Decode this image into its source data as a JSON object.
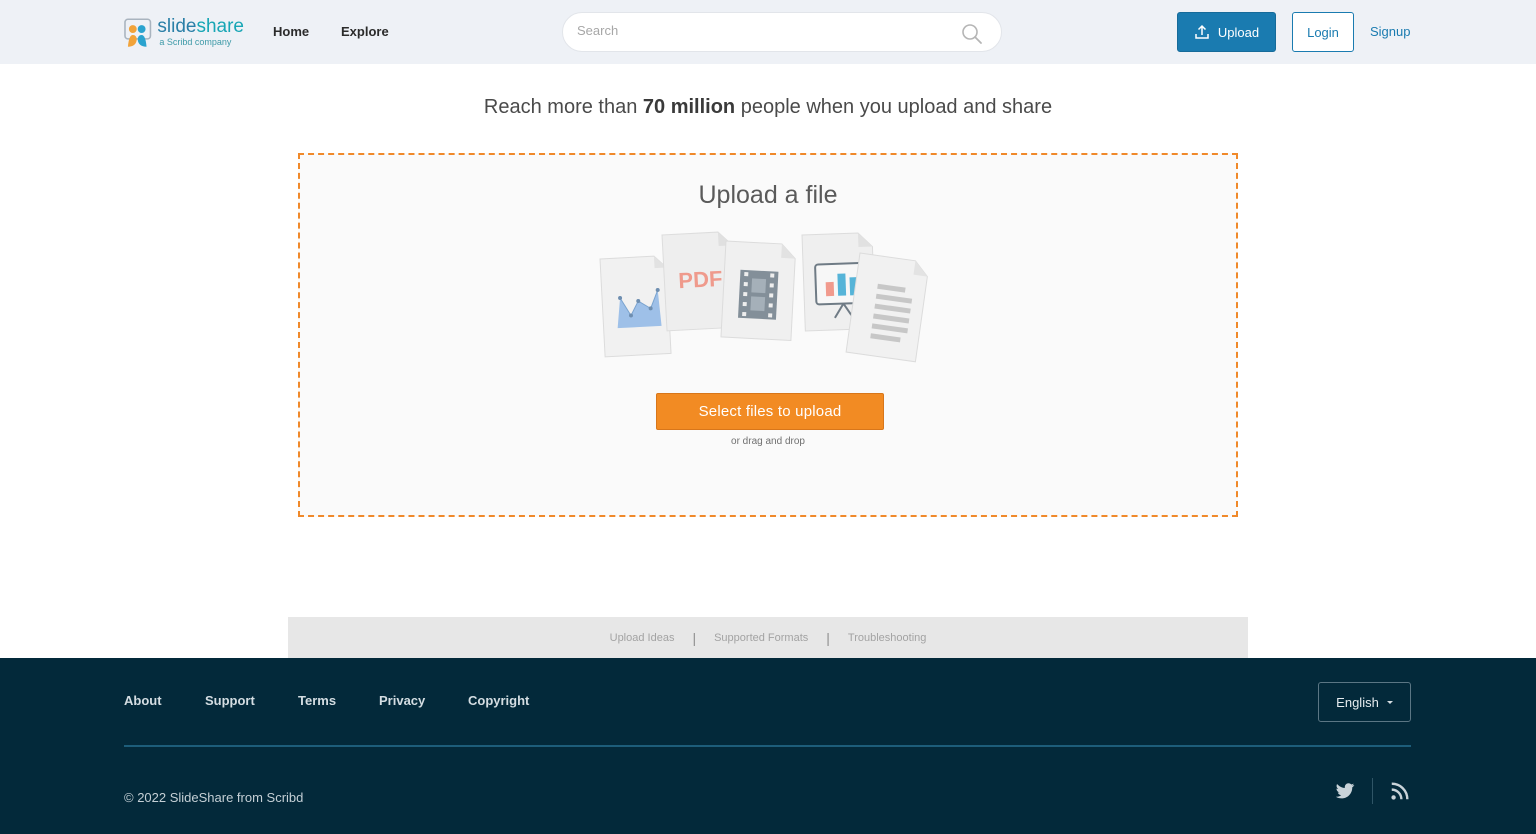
{
  "header": {
    "logo": {
      "word_a": "slide",
      "word_b": "share",
      "tagline": "a Scribd company"
    },
    "nav": {
      "home": "Home",
      "explore": "Explore"
    },
    "search": {
      "placeholder": "Search"
    },
    "upload_label": "Upload",
    "login_label": "Login",
    "signup_label": "Signup"
  },
  "main": {
    "headline": {
      "before": "Reach more than ",
      "bold": "70 million",
      "after": " people when you upload and share"
    },
    "upload": {
      "title": "Upload a file",
      "file_icons": [
        "chart-file-icon",
        "pdf-file-icon",
        "video-file-icon",
        "presentation-file-icon",
        "document-file-icon"
      ],
      "pdf_text": "PDF",
      "select_label": "Select files to upload",
      "drag_text": "or drag and drop"
    },
    "help": {
      "ideas": "Upload Ideas",
      "formats": "Supported Formats",
      "troubleshooting": "Troubleshooting",
      "separator": "|"
    }
  },
  "footer": {
    "links": {
      "about": "About",
      "support": "Support",
      "terms": "Terms",
      "privacy": "Privacy",
      "copyright": "Copyright"
    },
    "language": "English",
    "copyright_text": "© 2022 SlideShare from Scribd",
    "social_icons": [
      "twitter-icon",
      "rss-icon"
    ]
  },
  "colors": {
    "brand_blue": "#1a7bb0",
    "accent_orange": "#f28b23",
    "footer_bg": "#03293a",
    "header_bg": "#eef1f6"
  }
}
